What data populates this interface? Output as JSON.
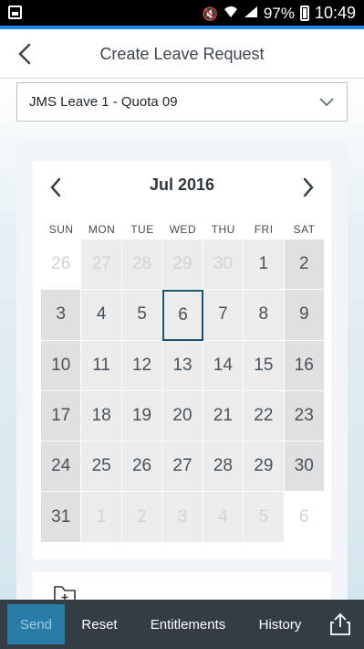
{
  "status_bar": {
    "battery": "97%",
    "time": "10:49",
    "icons": [
      "gallery-icon",
      "mute-icon",
      "wifi-icon",
      "signal-icon",
      "battery-icon"
    ]
  },
  "app_bar": {
    "title": "Create Leave Request",
    "back_icon": "chevron-left-icon"
  },
  "leave_type": {
    "selected": "JMS Leave 1 - Quota 09"
  },
  "calendar": {
    "month_label": "Jul 2016",
    "weekdays": [
      "SUN",
      "MON",
      "TUE",
      "WED",
      "THU",
      "FRI",
      "SAT"
    ],
    "selected_day": "6",
    "weeks": [
      [
        "26",
        "27",
        "28",
        "29",
        "30",
        "1",
        "2"
      ],
      [
        "3",
        "4",
        "5",
        "6",
        "7",
        "8",
        "9"
      ],
      [
        "10",
        "11",
        "12",
        "13",
        "14",
        "15",
        "16"
      ],
      [
        "17",
        "18",
        "19",
        "20",
        "21",
        "22",
        "23"
      ],
      [
        "24",
        "25",
        "26",
        "27",
        "28",
        "29",
        "30"
      ],
      [
        "31",
        "1",
        "2",
        "3",
        "4",
        "5",
        "6"
      ]
    ]
  },
  "footer": {
    "send": "Send",
    "reset": "Reset",
    "entitlements": "Entitlements",
    "history": "History",
    "share_icon": "share-icon"
  },
  "colors": {
    "accent": "#1e88e5",
    "selected_border": "#1d4f73",
    "footer_bg": "#343c44",
    "send_bg": "#2a7ca8"
  }
}
